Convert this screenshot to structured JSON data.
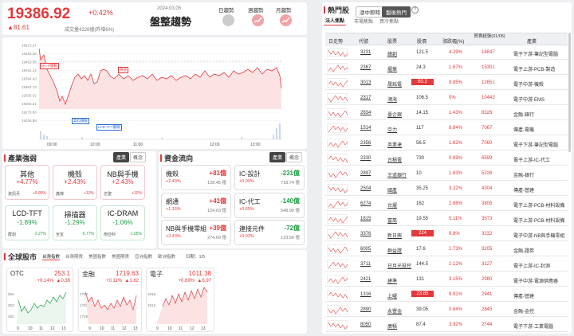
{
  "index": {
    "price": "19386.92",
    "change_pct": "+0.42%",
    "change": "▲81.61",
    "date": "2024.03.05",
    "volume": "成交量4228億(昨增6%)",
    "title": "盤整趨勢"
  },
  "trends": [
    {
      "label": "日趨勢"
    },
    {
      "label": "週趨勢"
    },
    {
      "label": "月趨勢"
    }
  ],
  "chart": {
    "y_labels": [
      "19513.27",
      "19483.56",
      "19453.85",
      "19424.14",
      "19394.43",
      "19364.73",
      "19335.02",
      "19305.31",
      "19275.60",
      "19245.89"
    ],
    "x_labels": [
      "09:00",
      "10:00",
      "11:00",
      "12:00",
      "13:00"
    ],
    "annotations": [
      "DC-P變動",
      "殊值",
      "質料價暖",
      "LCD-TFT變暖"
    ]
  },
  "industry": {
    "title": "產業強弱",
    "tabs": [
      "產業",
      "概念"
    ],
    "items": [
      {
        "name": "其他",
        "pct": "+4.77%",
        "f1": "資訊月",
        "v1": "+9.99%",
        "color": "red"
      },
      {
        "name": "機殼",
        "pct": "+2.43%",
        "f1": "鑫傑",
        "v1": "+10%",
        "color": "red"
      },
      {
        "name": "NB與手機",
        "pct": "+2.43%",
        "f1": "志聖",
        "v1": "+10%",
        "color": "red"
      },
      {
        "name": "LCD-TFT",
        "pct": "-1.89%",
        "f1": "群創",
        "v1": "-2.27%",
        "color": "green"
      },
      {
        "name": "掃描器",
        "pct": "-1.29%",
        "f1": "全友",
        "v1": "-5.77%",
        "color": "green"
      },
      {
        "name": "IC-DRAM",
        "pct": "-1.06%",
        "f1": "南亞科",
        "v1": "-1.05%",
        "color": "green"
      }
    ]
  },
  "capital": {
    "title": "資金流向",
    "tabs": [
      "產業",
      "概念"
    ],
    "items": [
      {
        "name": "機殼",
        "val": "+81億",
        "pct": "+2.43%",
        "amt": "128.45 億",
        "color": "red"
      },
      {
        "name": "IC-設計",
        "val": "-231億",
        "pct": "+0.09%",
        "amt": "718.74 億",
        "color": "green"
      },
      {
        "name": "網通",
        "val": "+41億",
        "pct": "+1.15%",
        "amt": "124.63 億",
        "color": "red"
      },
      {
        "name": "IC-代工",
        "val": "-140億",
        "pct": "+0.65%",
        "amt": "548.90 億",
        "color": "green"
      },
      {
        "name": "NB與手機零組",
        "val": "+39億",
        "pct": "+2.43%",
        "amt": "274.69 億",
        "color": "red"
      },
      {
        "name": "連接元件",
        "val": "-72億",
        "pct": "+0.93%",
        "amt": "133.56 億",
        "color": "green"
      }
    ]
  },
  "global": {
    "title": "全球股市",
    "tabs": [
      "台灣指數",
      "台灣期貨",
      "美國指數",
      "美國期貨",
      "亞洲指數",
      "歐洲指數"
    ],
    "day": "日期：1/5",
    "markets": [
      {
        "name": "OTC",
        "value": "253.1",
        "pct": "+0.14%",
        "chg": "▲0.36",
        "y": [
          "254",
          "253",
          "252"
        ],
        "x": [
          "9",
          "10",
          "11",
          "12",
          "13"
        ]
      },
      {
        "name": "金融",
        "value": "1719.63",
        "pct": "+0.11%",
        "chg": "▲1.82",
        "y": [
          "1724",
          "1720",
          "1718"
        ],
        "x": [
          "9",
          "10",
          "11",
          "12",
          "13"
        ]
      },
      {
        "name": "電子",
        "value": "1011.38",
        "pct": "+0.69%",
        "chg": "▲6.97",
        "y": [
          "1016",
          "1012"
        ],
        "x": [
          "9",
          "10",
          "11",
          "12",
          "13"
        ]
      }
    ]
  },
  "hot": {
    "title": "熱門股",
    "sub_tabs": [
      "漲中即時",
      "盤後熱門"
    ],
    "tabs": [
      "法人焦點",
      "市場焦點",
      "買冷焦點"
    ],
    "headers": [
      "日走勢",
      "代號",
      "股票",
      "股價",
      "漲跌幅(%)",
      "買賣超張(01/05)",
      "產業"
    ],
    "rows": [
      {
        "code": "3231",
        "name": "緯創",
        "price": "121.5",
        "pct": "4.29%",
        "net": "18847",
        "ind": "電子下游-筆記型電腦",
        "hl": false
      },
      {
        "code": "2367",
        "name": "燿華",
        "price": "24.3",
        "pct": "1.67%",
        "net": "15301",
        "ind": "電子上游-PCB-製造",
        "hl": false
      },
      {
        "code": "3013",
        "name": "晟銘電",
        "price": "60.2",
        "pct": "9.85%",
        "net": "12651",
        "ind": "電子中游-機殼",
        "hl": true
      },
      {
        "code": "2317",
        "name": "鴻海",
        "price": "106.5",
        "pct": "0%",
        "net": "10443",
        "ind": "電子中游-EMS",
        "hl": false
      },
      {
        "code": "2834",
        "name": "臺企銀",
        "price": "14.15",
        "pct": "1.43%",
        "net": "8326",
        "ind": "金融-銀行",
        "hl": false
      },
      {
        "code": "1514",
        "name": "亞力",
        "price": "117",
        "pct": "8.84%",
        "net": "7067",
        "ind": "傳產-電機",
        "hl": false
      },
      {
        "code": "2356",
        "name": "英業達",
        "price": "56.5",
        "pct": "1.62%",
        "net": "7060",
        "ind": "電子下游-筆記型電腦",
        "hl": false
      },
      {
        "code": "2330",
        "name": "台積電",
        "price": "730",
        "pct": "0.69%",
        "net": "6599",
        "ind": "電子上游-IC-代工",
        "hl": false
      },
      {
        "code": "2897",
        "name": "王道銀行",
        "price": "10",
        "pct": "1.63%",
        "net": "5226",
        "ind": "金融-銀行",
        "hl": false
      },
      {
        "code": "2504",
        "name": "國產",
        "price": "35.25",
        "pct": "3.22%",
        "net": "4304",
        "ind": "傳產-營建",
        "hl": false
      },
      {
        "code": "6274",
        "name": "台燿",
        "price": "162",
        "pct": "2.86%",
        "net": "3805",
        "ind": "電子上游-PCB-材料設備",
        "hl": false
      },
      {
        "code": "1815",
        "name": "富喬",
        "price": "19.55",
        "pct": "5.11%",
        "net": "3573",
        "ind": "電子上游-PCB-材料設備",
        "hl": false
      },
      {
        "code": "3376",
        "name": "新日興",
        "price": "224",
        "pct": "9.8%",
        "net": "3232",
        "ind": "電子中游-NB與手機零組",
        "hl": true
      },
      {
        "code": "6005",
        "name": "群益證",
        "price": "17.6",
        "pct": "1.73%",
        "net": "3205",
        "ind": "金融-證券",
        "hl": false
      },
      {
        "code": "3711",
        "name": "日月光投控",
        "price": "144.5",
        "pct": "2.12%",
        "net": "3127",
        "ind": "電子上游-IC-封測",
        "hl": false
      },
      {
        "code": "2421",
        "name": "建準",
        "price": "131",
        "pct": "3.15%",
        "net": "2980",
        "ind": "電子中游-電源供應器",
        "hl": false
      },
      {
        "code": "1316",
        "name": "上曜",
        "price": "23.85",
        "pct": "9.91%",
        "net": "2941",
        "ind": "傳產-營建",
        "hl": true
      },
      {
        "code": "2890",
        "name": "永豐金",
        "price": "39.05",
        "pct": "0.64%",
        "net": "2845",
        "ind": "金融-金控",
        "hl": false
      },
      {
        "code": "8050",
        "name": "廣積",
        "price": "87.4",
        "pct": "3.92%",
        "net": "2744",
        "ind": "電子下游-工業電腦",
        "hl": false
      }
    ]
  },
  "colors": {
    "up": "#e5383b",
    "down": "#22a046",
    "accent": "#e5383b"
  }
}
